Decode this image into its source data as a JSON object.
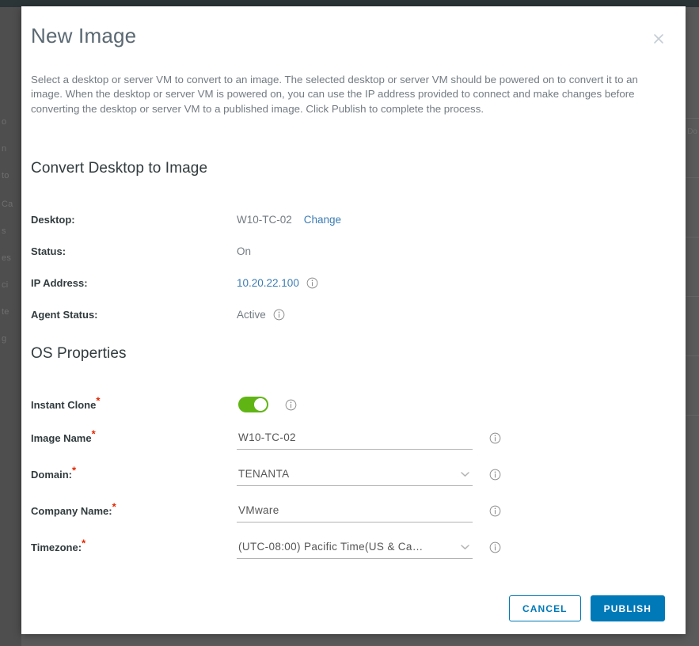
{
  "backdrop": {
    "nav_items": [
      "o",
      "n",
      "to",
      "Ca",
      "s",
      "es",
      "ci",
      "te",
      "g"
    ],
    "right_label": "Do",
    "colors": {
      "overlay": "#5a5a5a",
      "header": "#2b3437"
    }
  },
  "modal": {
    "title": "New Image",
    "close_icon": "close-icon",
    "description": "Select a desktop or server VM to convert to an image. The selected desktop or server VM should be powered on to convert it to an image. When the desktop or server VM is powered on, you can use the IP address provided to connect and make changes before converting the desktop or server VM to a published image. Click Publish to complete the process.",
    "sections": {
      "convert": {
        "title": "Convert Desktop to Image",
        "rows": [
          {
            "label": "Desktop:",
            "value": "W10-TC-02",
            "link": "Change",
            "info": false
          },
          {
            "label": "Status:",
            "value": "On",
            "link": "",
            "info": false
          },
          {
            "label": "IP Address:",
            "value": "10.20.22.100",
            "link": "",
            "info": true,
            "value_is_link": true
          },
          {
            "label": "Agent Status:",
            "value": "Active",
            "link": "",
            "info": true
          }
        ]
      },
      "os_properties": {
        "title": "OS Properties",
        "fields": [
          {
            "label": "Instant Clone",
            "required": true,
            "type": "toggle",
            "value": "on",
            "info": true
          },
          {
            "label": "Image Name",
            "required": true,
            "type": "text",
            "value": "W10-TC-02",
            "info": true
          },
          {
            "label": "Domain:",
            "required": true,
            "type": "select",
            "value": "TENANTA",
            "info": true
          },
          {
            "label": "Company Name:",
            "required": true,
            "type": "text",
            "value": "VMware",
            "info": true
          },
          {
            "label": "Timezone:",
            "required": true,
            "type": "select",
            "value": "(UTC-08:00) Pacific Time(US & Ca…",
            "info": true
          }
        ]
      }
    },
    "footer": {
      "cancel_label": "CANCEL",
      "publish_label": "PUBLISH"
    }
  },
  "colors": {
    "accent": "#0079b8",
    "link": "#3b7cb3",
    "required": "#e62700",
    "toggle_on": "#60b515",
    "title": "#5a6872",
    "body_text": "#737b82"
  }
}
